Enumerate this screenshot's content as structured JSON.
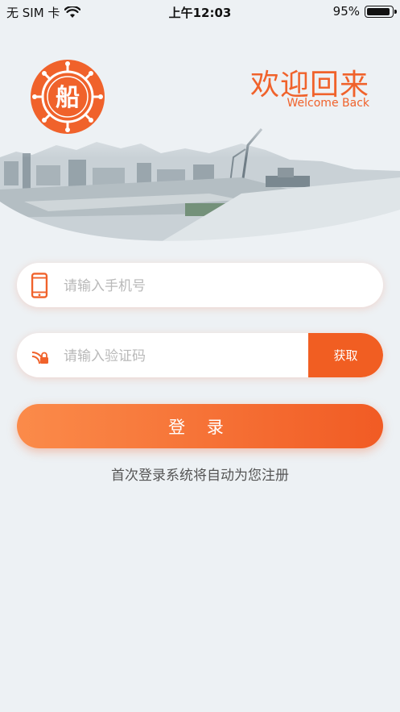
{
  "status_bar": {
    "carrier": "无 SIM 卡",
    "time": "上午12:03",
    "battery_percent": "95%",
    "battery_level": 0.95,
    "wifi_icon": "wifi-icon"
  },
  "logo": {
    "icon": "ship-wheel-logo",
    "glyph": "船",
    "color": "#f0622b"
  },
  "welcome": {
    "title": "欢迎回来",
    "subtitle": "Welcome Back"
  },
  "phone_field": {
    "icon": "phone-icon",
    "placeholder": "请输入手机号",
    "value": ""
  },
  "code_field": {
    "icon": "verification-code-icon",
    "placeholder": "请输入验证码",
    "value": "",
    "button_label": "获取"
  },
  "login_button": {
    "label": "登 录"
  },
  "register_hint": "首次登录系统将自动为您注册",
  "colors": {
    "accent": "#f0622b",
    "button_gradient_start": "#fb8b4a",
    "button_gradient_end": "#f15b24",
    "background": "#edf1f4"
  }
}
